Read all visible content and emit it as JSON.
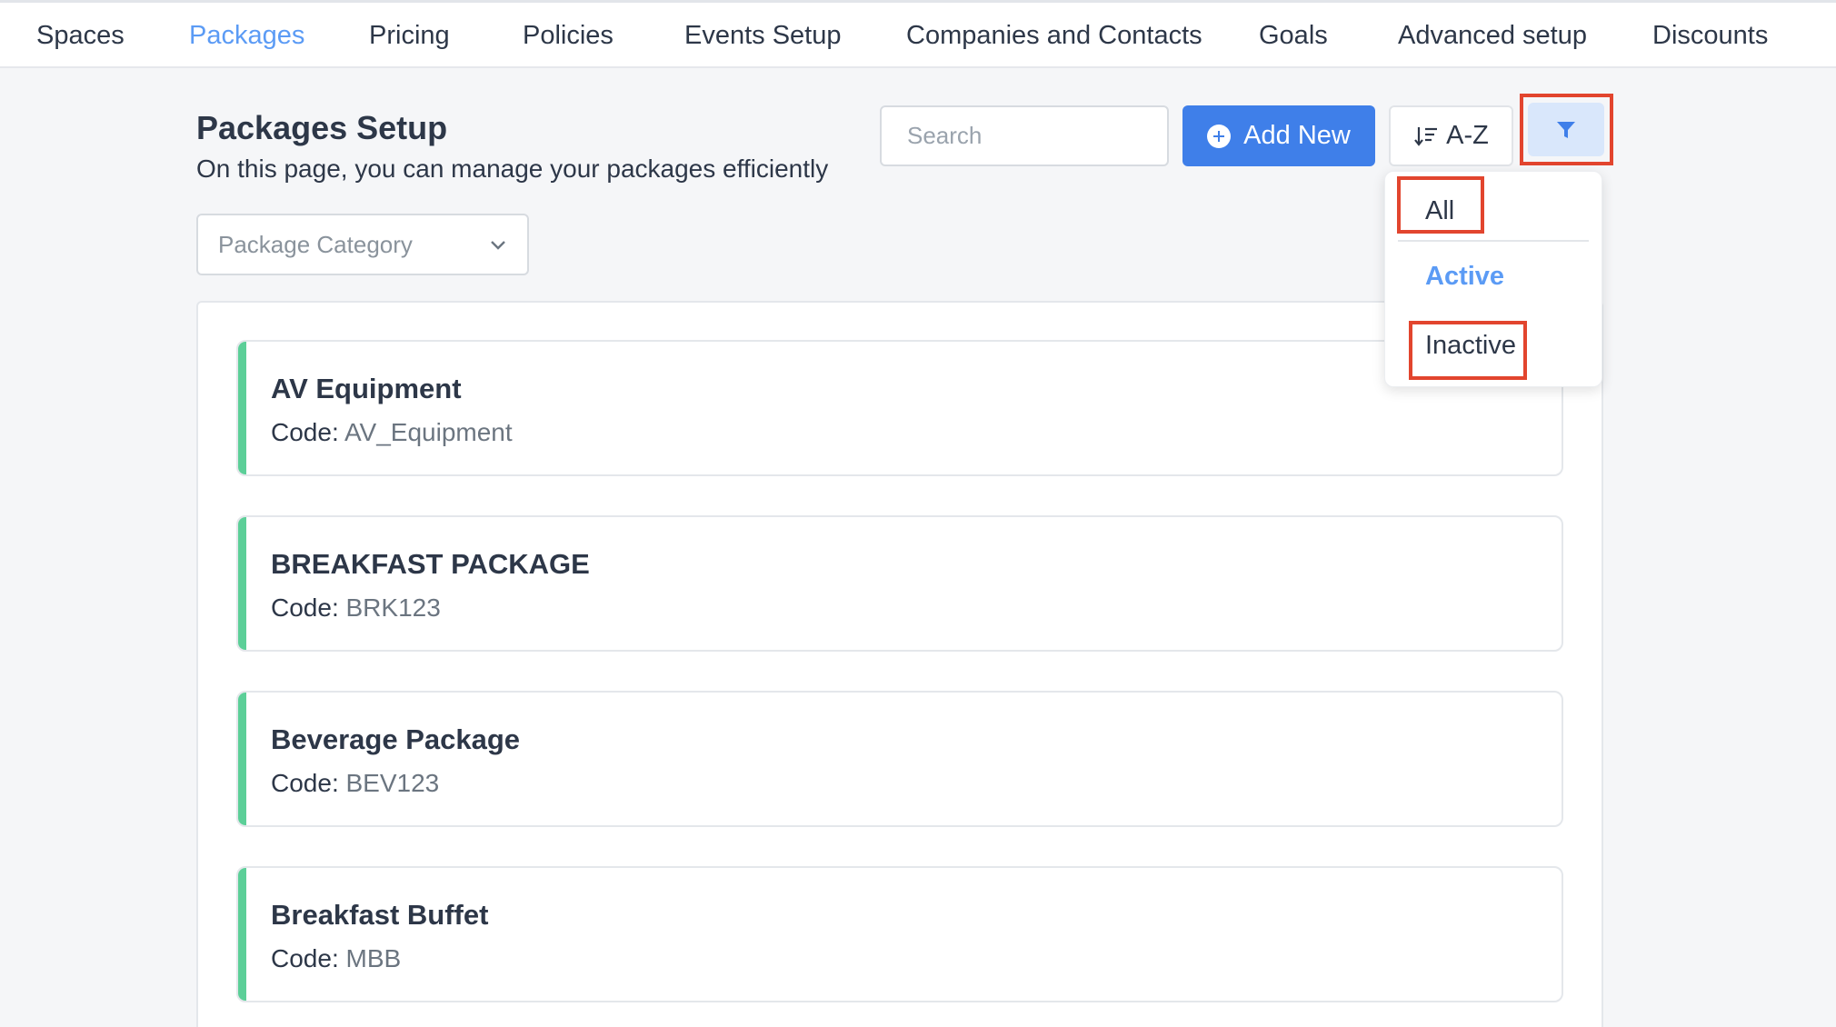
{
  "nav": {
    "items": [
      {
        "label": "Spaces",
        "active": false
      },
      {
        "label": "Packages",
        "active": true
      },
      {
        "label": "Pricing",
        "active": false
      },
      {
        "label": "Policies",
        "active": false
      },
      {
        "label": "Events Setup",
        "active": false
      },
      {
        "label": "Companies and Contacts",
        "active": false
      },
      {
        "label": "Goals",
        "active": false
      },
      {
        "label": "Advanced setup",
        "active": false
      },
      {
        "label": "Discounts",
        "active": false
      }
    ]
  },
  "header": {
    "title": "Packages Setup",
    "subtitle": "On this page, you can manage your packages efficiently"
  },
  "toolbar": {
    "search_placeholder": "Search",
    "add_label": "Add New",
    "sort_label": "A-Z"
  },
  "filter_menu": {
    "options": [
      {
        "label": "All",
        "active": false
      },
      {
        "label": "Active",
        "active": true
      },
      {
        "label": "Inactive",
        "active": false
      }
    ]
  },
  "category": {
    "placeholder": "Package Category"
  },
  "packages": [
    {
      "name": "AV Equipment",
      "code_label": "Code:",
      "code": "AV_Equipment"
    },
    {
      "name": "BREAKFAST PACKAGE",
      "code_label": "Code:",
      "code": "BRK123"
    },
    {
      "name": "Beverage Package",
      "code_label": "Code:",
      "code": "BEV123"
    },
    {
      "name": "Breakfast Buffet",
      "code_label": "Code:",
      "code": "MBB"
    }
  ],
  "colors": {
    "accent": "#3f7fe9",
    "active_link": "#5b9bf5",
    "card_accent": "#5ccf98",
    "highlight": "#e2452e"
  }
}
